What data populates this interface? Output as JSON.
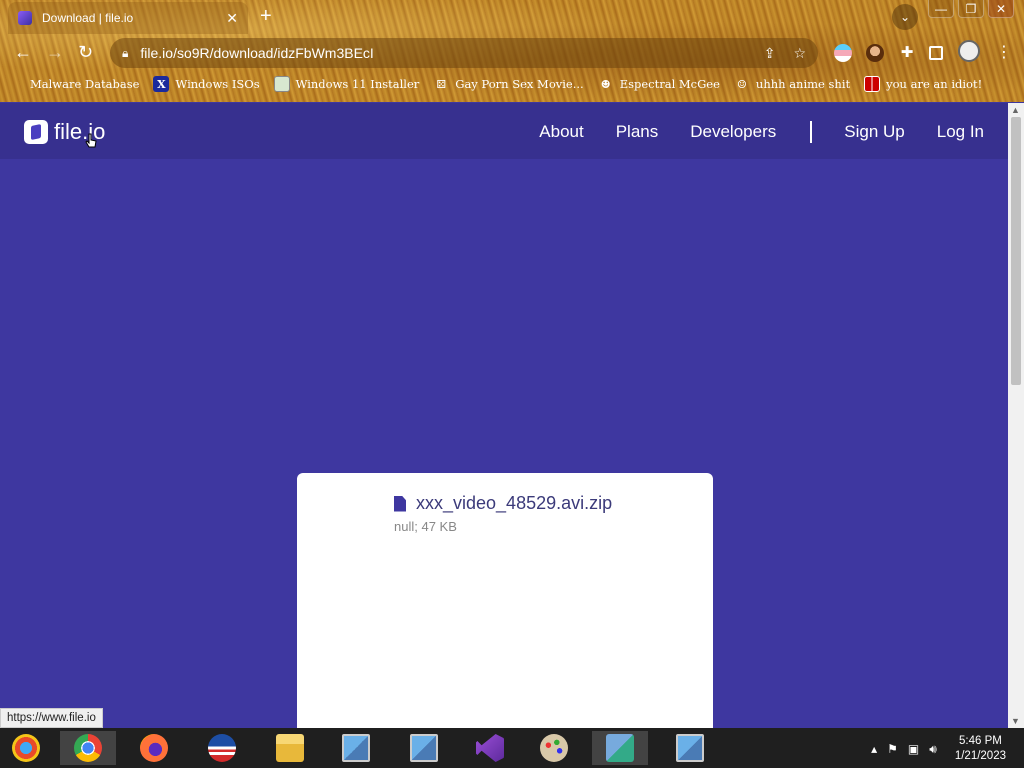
{
  "browser": {
    "tab_title": "Download | file.io",
    "close_tab": "✕",
    "new_tab": "+",
    "url": "file.io/so9R/download/idzFbWm3BEcI",
    "window_buttons": {
      "minimize": "—",
      "restore": "❐",
      "close": "✕"
    },
    "bookmarks": [
      {
        "label": "Malware Database"
      },
      {
        "label": "Windows ISOs"
      },
      {
        "label": "Windows 11 Installer"
      },
      {
        "label": "Gay Porn Sex Movie..."
      },
      {
        "label": "Espectral McGee"
      },
      {
        "label": "uhhh anime shit"
      },
      {
        "label": "you are an idiot!"
      }
    ],
    "status_url": "https://www.file.io"
  },
  "site": {
    "logo_text": "file.io",
    "nav": {
      "about": "About",
      "plans": "Plans",
      "developers": "Developers",
      "signup": "Sign Up",
      "login": "Log In"
    }
  },
  "file": {
    "name": "xxx_video_48529.avi.zip",
    "meta": "null; 47 KB"
  },
  "taskbar": {
    "time": "5:46 PM",
    "date": "1/21/2023"
  },
  "colors": {
    "page_bg": "#3e37a0",
    "nav_bg": "#37308f",
    "card_bg": "#ffffff"
  }
}
